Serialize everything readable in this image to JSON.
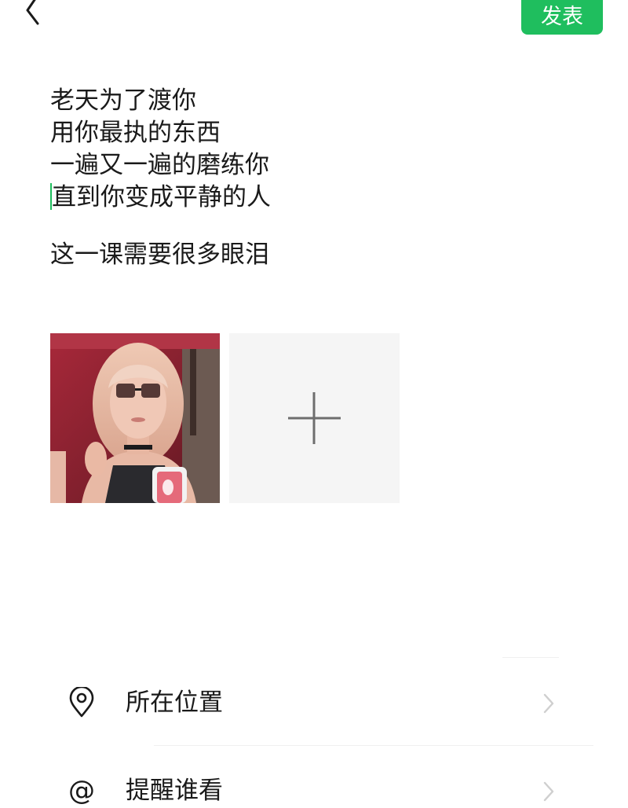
{
  "header": {
    "back_icon": "chevron-left-icon",
    "publish_label": "发表",
    "accent_color": "#1fbe5e"
  },
  "post": {
    "lines": [
      "老天为了渡你",
      "用你最执的东西",
      "一遍又一遍的磨练你",
      "直到你变成平静的人",
      "",
      "这一课需要很多眼泪"
    ]
  },
  "photos": {
    "attached": [
      {
        "description_icon": "photo-thumbnail"
      }
    ],
    "add_icon": "plus-icon"
  },
  "options": {
    "location": {
      "label": "所在位置",
      "icon": "location-pin-icon"
    },
    "mention": {
      "label": "提醒谁看",
      "icon": "at-icon"
    },
    "chevron_icon": "chevron-right-icon"
  }
}
